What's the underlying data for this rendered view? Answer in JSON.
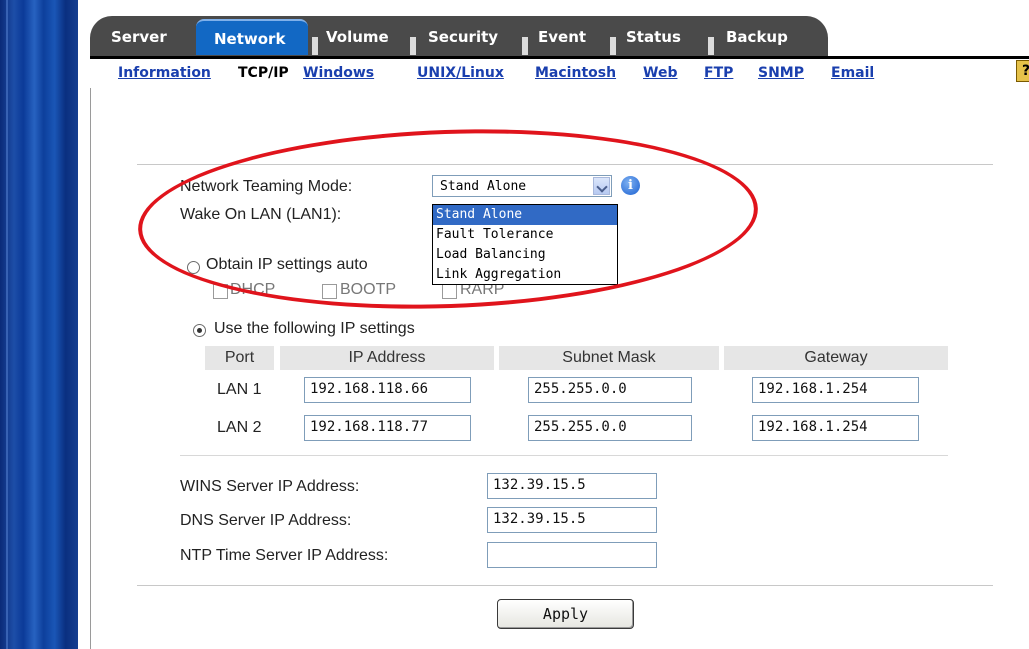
{
  "tabs": [
    {
      "label": "Server"
    },
    {
      "label": "Network",
      "active": true
    },
    {
      "label": "Volume"
    },
    {
      "label": "Security"
    },
    {
      "label": "Event"
    },
    {
      "label": "Status"
    },
    {
      "label": "Backup"
    }
  ],
  "subnav": [
    "Information",
    "TCP/IP",
    "Windows",
    "UNIX/Linux",
    "Macintosh",
    "Web",
    "FTP",
    "SNMP",
    "Email"
  ],
  "help_glyph": "?",
  "teaming": {
    "label": "Network Teaming Mode:",
    "selected": "Stand Alone",
    "options": [
      "Stand Alone",
      "Fault Tolerance",
      "Load Balancing",
      "Link Aggregation"
    ],
    "info_glyph": "i"
  },
  "wol": {
    "label": "Wake On LAN (LAN1):"
  },
  "obtain": {
    "label": "Obtain IP settings auto",
    "selected": false,
    "dhcp": "DHCP",
    "bootp": "BOOTP",
    "rarp": "RARP"
  },
  "use_following": {
    "label": "Use the following IP settings",
    "selected": true
  },
  "table": {
    "headers": [
      "Port",
      "IP Address",
      "Subnet Mask",
      "Gateway"
    ],
    "rows": [
      {
        "port": "LAN 1",
        "ip": "192.168.118.66",
        "mask": "255.255.0.0",
        "gateway": "192.168.1.254"
      },
      {
        "port": "LAN 2",
        "ip": "192.168.118.77",
        "mask": "255.255.0.0",
        "gateway": "192.168.1.254"
      }
    ]
  },
  "servers": {
    "wins_label": "WINS Server IP Address:",
    "wins_value": "132.39.15.5",
    "dns_label": "DNS Server IP Address:",
    "dns_value": "132.39.15.5",
    "ntp_label": "NTP Time Server IP Address:",
    "ntp_value": ""
  },
  "apply_label": "Apply",
  "colors": {
    "annotation": "#e0141c",
    "active_tab": "#1268c4",
    "selection": "#316ac5"
  }
}
